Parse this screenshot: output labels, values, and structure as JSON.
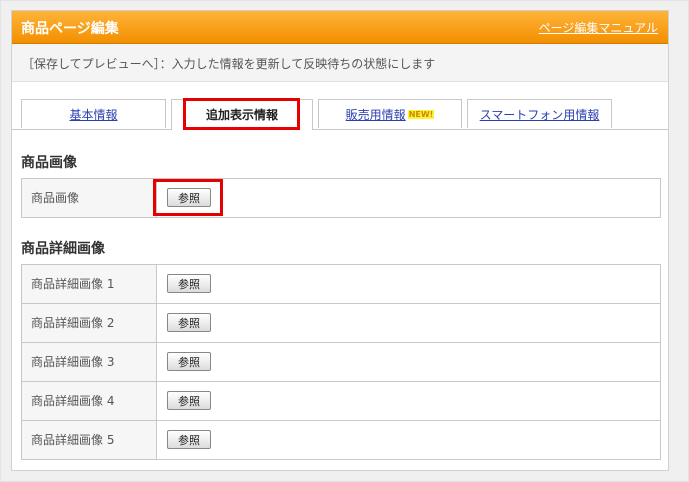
{
  "header": {
    "title": "商品ページ編集",
    "manual_link": "ページ編集マニュアル"
  },
  "notice": "［保存してプレビューへ］：入力した情報を更新して反映待ちの状態にします",
  "tabs": [
    {
      "label": "基本情報",
      "active": false
    },
    {
      "label": "追加表示情報",
      "active": true
    },
    {
      "label": "販売用情報",
      "badge": "NEW!",
      "active": false
    },
    {
      "label": "スマートフォン用情報",
      "active": false
    }
  ],
  "product_image_section": {
    "title": "商品画像",
    "rows": [
      {
        "label": "商品画像",
        "button": "参照"
      }
    ]
  },
  "detail_image_section": {
    "title": "商品詳細画像",
    "rows": [
      {
        "label": "商品詳細画像 1",
        "button": "参照"
      },
      {
        "label": "商品詳細画像 2",
        "button": "参照"
      },
      {
        "label": "商品詳細画像 3",
        "button": "参照"
      },
      {
        "label": "商品詳細画像 4",
        "button": "参照"
      },
      {
        "label": "商品詳細画像 5",
        "button": "参照"
      }
    ]
  },
  "colors": {
    "header_orange": "#f7a21b",
    "highlight_red": "#e60000",
    "link_blue": "#2a3fb0"
  }
}
